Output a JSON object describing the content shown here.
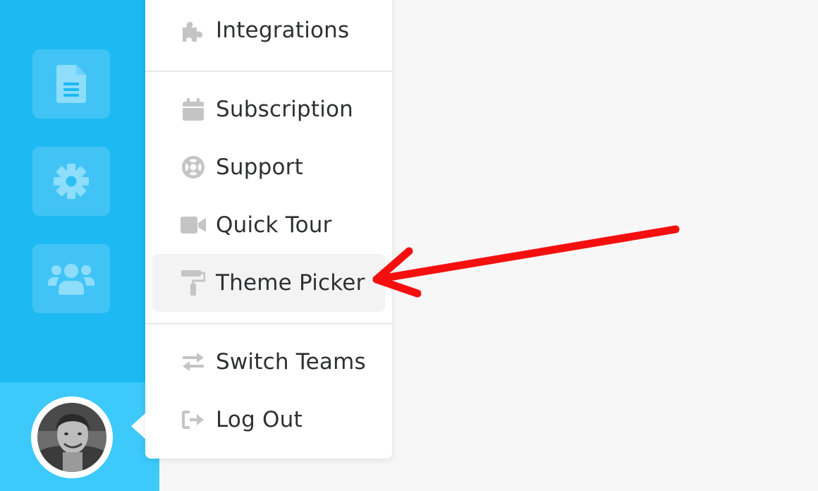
{
  "sidebar": {
    "nav": [
      {
        "icon": "document-icon"
      },
      {
        "icon": "gear-icon"
      },
      {
        "icon": "users-icon"
      }
    ],
    "avatar": {
      "icon": "user-avatar"
    }
  },
  "menu": {
    "items": [
      {
        "label": "Integrations",
        "icon": "puzzle-icon"
      },
      {
        "label": "Subscription",
        "icon": "calendar-icon"
      },
      {
        "label": "Support",
        "icon": "lifebuoy-icon"
      },
      {
        "label": "Quick Tour",
        "icon": "video-camera-icon"
      },
      {
        "label": "Theme Picker",
        "icon": "paint-roller-icon",
        "highlighted": true
      },
      {
        "label": "Switch Teams",
        "icon": "exchange-icon"
      },
      {
        "label": "Log Out",
        "icon": "sign-out-icon"
      }
    ]
  },
  "annotation": {
    "type": "arrow",
    "color": "#f40f0f",
    "target": "Theme Picker"
  },
  "colors": {
    "sidebar": "#1db9f3",
    "sidebar_bottom": "#3dc9fa",
    "menu_background": "#ffffff",
    "menu_icon": "#c4c4c4",
    "menu_text": "#2f3033",
    "highlight": "#f3f3f3",
    "page_background": "#f7f7f7"
  }
}
